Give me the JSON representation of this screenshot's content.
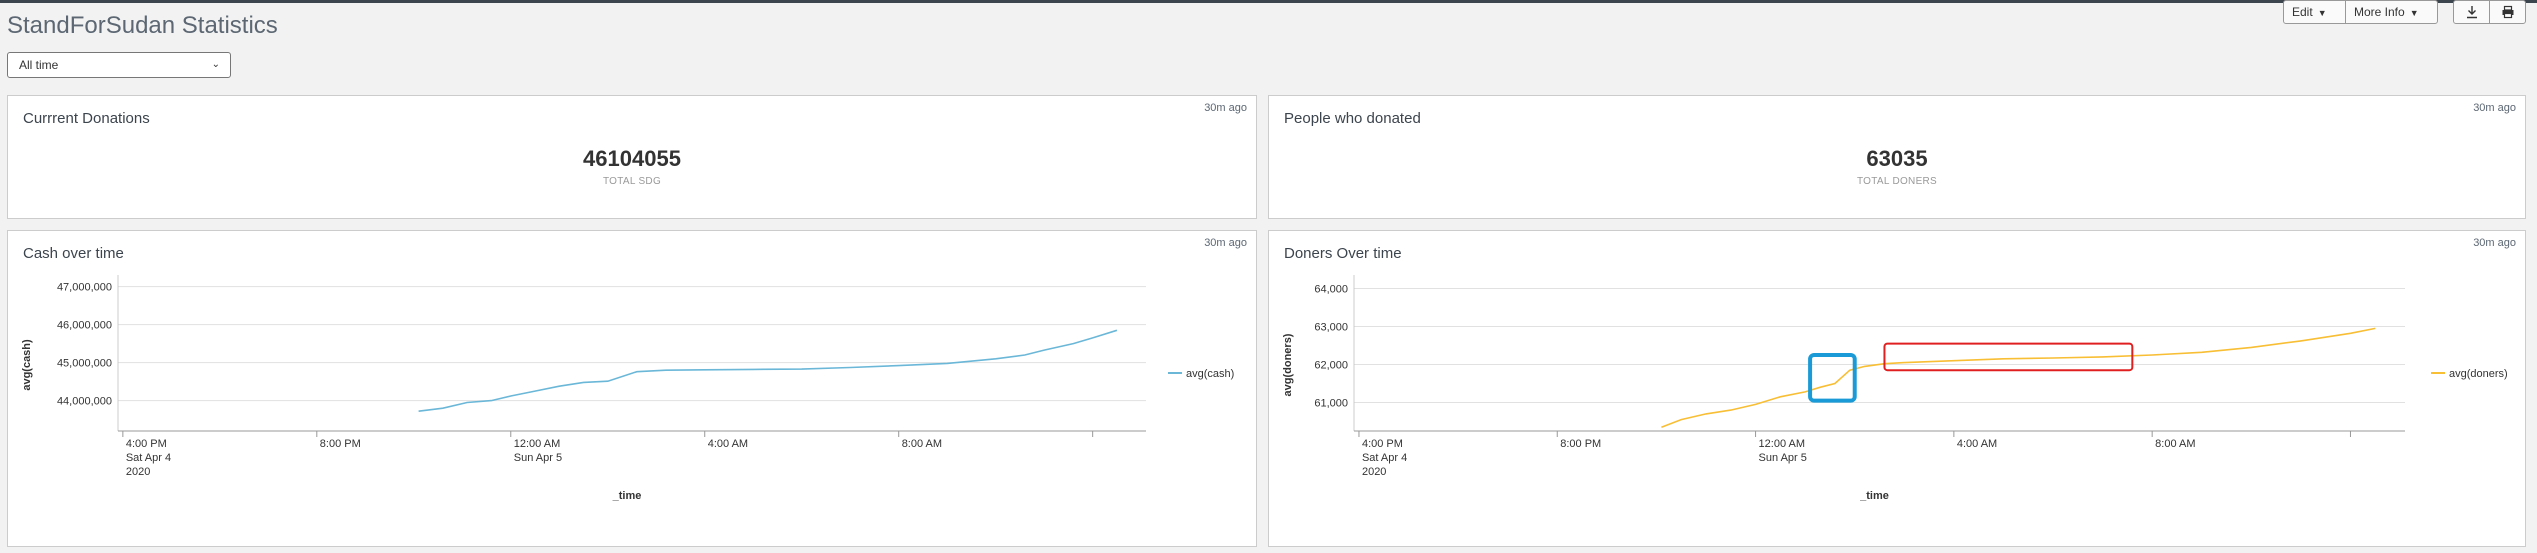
{
  "dashboard": {
    "title": "StandForSudan Statistics",
    "edit_label": "Edit",
    "more_info_label": "More Info",
    "download_icon": "download-icon",
    "print_icon": "print-icon"
  },
  "time_picker": {
    "value": "All time"
  },
  "panels": {
    "donations": {
      "title": "Currrent Donations",
      "value": "46104055",
      "unit": "TOTAL SDG",
      "updated": "30m ago"
    },
    "people": {
      "title": "People who donated",
      "value": "63035",
      "unit": "TOTAL DONERS",
      "updated": "30m ago"
    },
    "cash": {
      "title": "Cash over time",
      "updated": "30m ago"
    },
    "doners": {
      "title": "Doners Over time",
      "updated": "30m ago"
    }
  },
  "colors": {
    "cash_line": "#6ab7d8",
    "doners_line": "#f8be34",
    "highlight_blue": "#1a9bd7",
    "highlight_red": "#e02020"
  },
  "chart_data": [
    {
      "type": "line",
      "title": "Cash over time",
      "xlabel": "_time",
      "ylabel": "avg(cash)",
      "x_ticks": [
        {
          "hour": 0,
          "lines": [
            "4:00 PM",
            "Sat Apr 4",
            "2020"
          ]
        },
        {
          "hour": 4,
          "lines": [
            "8:00 PM"
          ]
        },
        {
          "hour": 8,
          "lines": [
            "12:00 AM",
            "Sun Apr 5"
          ]
        },
        {
          "hour": 12,
          "lines": [
            "4:00 AM"
          ]
        },
        {
          "hour": 16,
          "lines": [
            "8:00 AM"
          ]
        },
        {
          "hour": 20,
          "lines": [
            ""
          ]
        }
      ],
      "x_range_hours": [
        -0.1,
        21.1
      ],
      "y_ticks": [
        {
          "value": 44000000,
          "label": "44,000,000"
        },
        {
          "value": 45000000,
          "label": "45,000,000"
        },
        {
          "value": 46000000,
          "label": "46,000,000"
        },
        {
          "value": 47000000,
          "label": "47,000,000"
        }
      ],
      "ylim": [
        43200000,
        47200000
      ],
      "grid": true,
      "legend_position": "right",
      "series": [
        {
          "name": "avg(cash)",
          "hours": [
            6.1,
            6.6,
            7.1,
            7.6,
            8.0,
            8.5,
            9.0,
            9.5,
            10.0,
            10.6,
            11.2,
            12.0,
            13.0,
            14.0,
            15.0,
            16.0,
            17.0,
            18.0,
            18.6,
            19.0,
            19.6,
            20.0,
            20.5
          ],
          "values": [
            43720000,
            43800000,
            43950000,
            44000000,
            44120000,
            44250000,
            44380000,
            44480000,
            44510000,
            44760000,
            44800000,
            44810000,
            44820000,
            44830000,
            44870000,
            44920000,
            44980000,
            45100000,
            45200000,
            45330000,
            45500000,
            45650000,
            45850000
          ]
        }
      ]
    },
    {
      "type": "line",
      "title": "Doners Over time",
      "xlabel": "_time",
      "ylabel": "avg(doners)",
      "x_ticks": [
        {
          "hour": 0,
          "lines": [
            "4:00 PM",
            "Sat Apr 4",
            "2020"
          ]
        },
        {
          "hour": 4,
          "lines": [
            "8:00 PM"
          ]
        },
        {
          "hour": 8,
          "lines": [
            "12:00 AM",
            "Sun Apr 5"
          ]
        },
        {
          "hour": 12,
          "lines": [
            "4:00 AM"
          ]
        },
        {
          "hour": 16,
          "lines": [
            "8:00 AM"
          ]
        },
        {
          "hour": 20,
          "lines": [
            ""
          ]
        }
      ],
      "x_range_hours": [
        -0.1,
        21.1
      ],
      "y_ticks": [
        {
          "value": 61000,
          "label": "61,000"
        },
        {
          "value": 62000,
          "label": "62,000"
        },
        {
          "value": 63000,
          "label": "63,000"
        },
        {
          "value": 64000,
          "label": "64,000"
        }
      ],
      "ylim": [
        60250,
        64250
      ],
      "grid": true,
      "legend_position": "right",
      "series": [
        {
          "name": "avg(doners)",
          "hours": [
            6.1,
            6.5,
            7.0,
            7.5,
            8.0,
            8.5,
            9.0,
            9.3,
            9.6,
            9.9,
            10.2,
            10.6,
            11.0,
            12.0,
            13.0,
            14.0,
            15.0,
            16.0,
            17.0,
            18.0,
            19.0,
            20.0,
            20.5
          ],
          "values": [
            60350,
            60550,
            60700,
            60800,
            60950,
            61150,
            61280,
            61400,
            61500,
            61850,
            61950,
            62020,
            62050,
            62100,
            62150,
            62170,
            62200,
            62250,
            62320,
            62450,
            62620,
            62820,
            62950
          ]
        }
      ],
      "highlights": [
        {
          "color": "blue",
          "hours": [
            9.1,
            10.0
          ],
          "values": [
            61050,
            62250
          ]
        },
        {
          "color": "red",
          "hours": [
            10.6,
            15.6
          ],
          "values": [
            61850,
            62550
          ]
        }
      ]
    }
  ]
}
